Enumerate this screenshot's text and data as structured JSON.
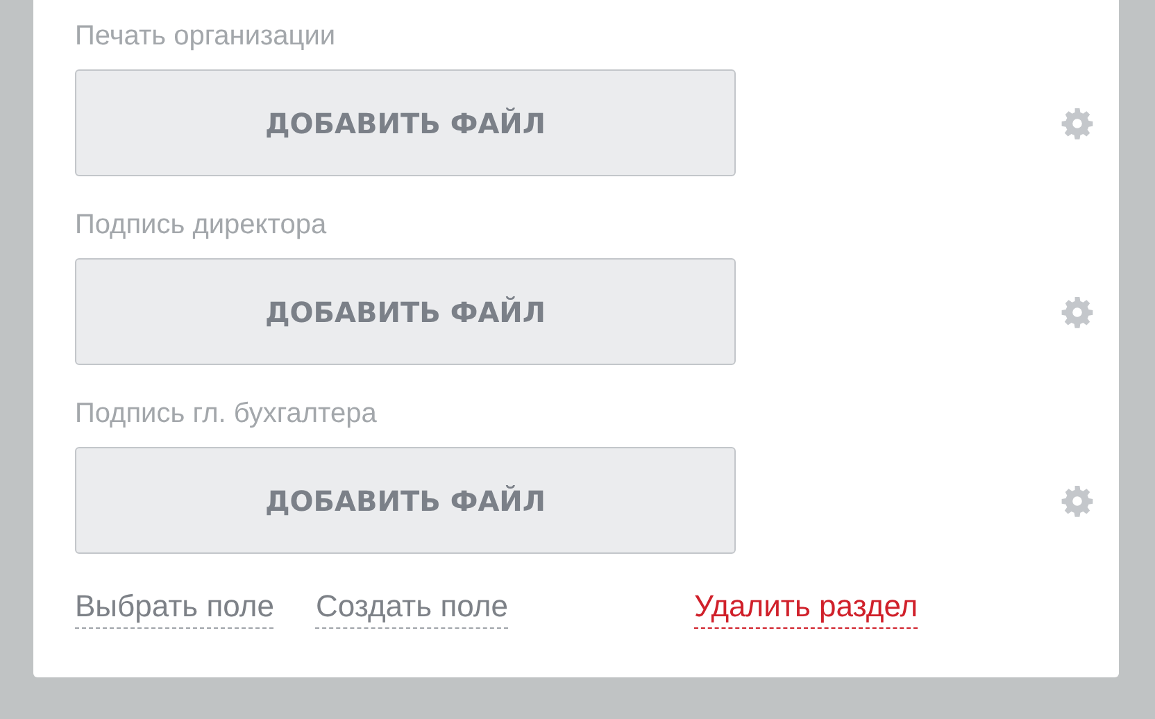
{
  "fields": [
    {
      "label": "Печать организации",
      "button": "ДОБАВИТЬ ФАЙЛ"
    },
    {
      "label": "Подпись директора",
      "button": "ДОБАВИТЬ ФАЙЛ"
    },
    {
      "label": "Подпись гл. бухгалтера",
      "button": "ДОБАВИТЬ ФАЙЛ"
    }
  ],
  "links": [
    {
      "text": "Выбрать поле",
      "kind": "neutral"
    },
    {
      "text": "Создать поле",
      "kind": "neutral"
    },
    {
      "text": "Удалить раздел",
      "kind": "danger"
    }
  ]
}
